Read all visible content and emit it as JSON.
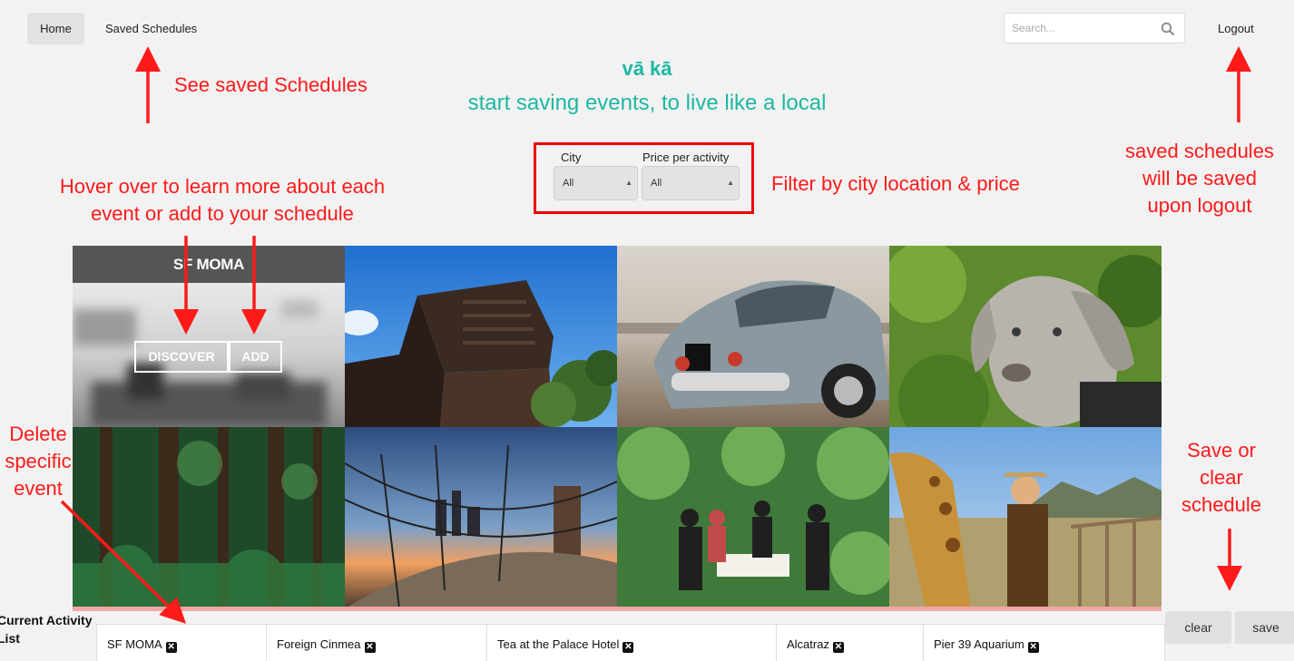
{
  "nav": {
    "home": "Home",
    "saved": "Saved Schedules",
    "logout": "Logout"
  },
  "search": {
    "placeholder": "Search..."
  },
  "brand": "vā kā",
  "tagline": "start saving events, to live like a local",
  "filters": {
    "city_label": "City",
    "city_value": "All",
    "price_label": "Price per activity",
    "price_value": "All"
  },
  "annotations": {
    "saved": "See saved Schedules",
    "hover": "Hover over to learn more about each\nevent or add to your schedule",
    "filter": "Filter by city location & price",
    "logout": "saved schedules\nwill be saved\nupon logout",
    "delete": "Delete\nspecific\nevent",
    "saveclear": "Save or\nclear\nschedule"
  },
  "featured": {
    "title": "SF MOMA",
    "discover": "DISCOVER",
    "add": "ADD"
  },
  "current_activity_label": "Current Activity\nList",
  "activities": [
    "SF MOMA",
    "Foreign Cinmea",
    "Tea at the Palace Hotel",
    "Alcatraz",
    "Pier 39 Aquarium"
  ],
  "buttons": {
    "clear": "clear",
    "save": "save"
  },
  "colors": {
    "accent": "#1db8a3",
    "annotation": "#ff1a1a"
  }
}
